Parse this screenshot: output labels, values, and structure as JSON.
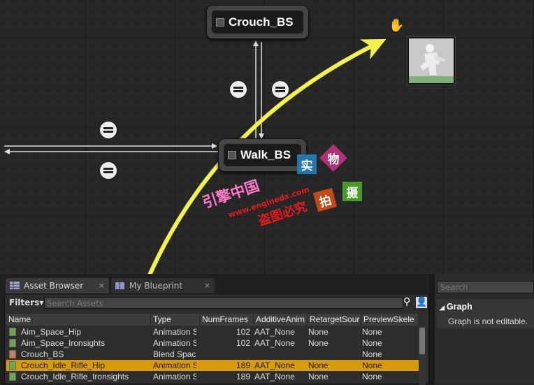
{
  "graph": {
    "states": [
      {
        "id": "crouch",
        "label": "Crouch_BS"
      },
      {
        "id": "walk",
        "label": "Walk_BS"
      }
    ]
  },
  "watermark": {
    "site_cn": "引擎中国",
    "site_url": "www.enginedx.com",
    "warning": "盗图必究",
    "badges": [
      "实",
      "物",
      "拍",
      "摄"
    ]
  },
  "tabs": [
    {
      "label": "Asset Browser",
      "close": "×"
    },
    {
      "label": "My Blueprint",
      "close": "×"
    }
  ],
  "asset_browser": {
    "filters_label": "Filters▾",
    "search_placeholder": "Search Assets",
    "columns": [
      "Name",
      "Type",
      "NumFrames",
      "AdditiveAnim",
      "RetargetSour",
      "PreviewSkele"
    ],
    "rows": [
      {
        "name": "Aim_Space_Hip",
        "type": "Animation S",
        "frames": "102",
        "additive": "AAT_None",
        "retarget": "None",
        "preview": "None",
        "selected": false
      },
      {
        "name": "Aim_Space_Ironsights",
        "type": "Animation S",
        "frames": "102",
        "additive": "AAT_None",
        "retarget": "None",
        "preview": "None",
        "selected": false
      },
      {
        "name": "Crouch_BS",
        "type": "Blend Spac",
        "frames": "",
        "additive": "",
        "retarget": "",
        "preview": "None",
        "selected": false
      },
      {
        "name": "Crouch_Idle_Rifle_Hip",
        "type": "Animation S",
        "frames": "189",
        "additive": "AAT_None",
        "retarget": "None",
        "preview": "None",
        "selected": true
      },
      {
        "name": "Crouch_Idle_Rifle_Ironsights",
        "type": "Animation S",
        "frames": "189",
        "additive": "AAT_None",
        "retarget": "None",
        "preview": "None",
        "selected": false
      }
    ]
  },
  "right_panel": {
    "search_placeholder": "Search",
    "section_title": "Graph",
    "note": "Graph is not editable."
  },
  "colors": {
    "selection": "#d99a07",
    "arrow": "#f2f24a",
    "blend_space_icon": "#c9805a",
    "animation_icon": "#6aa84f"
  }
}
